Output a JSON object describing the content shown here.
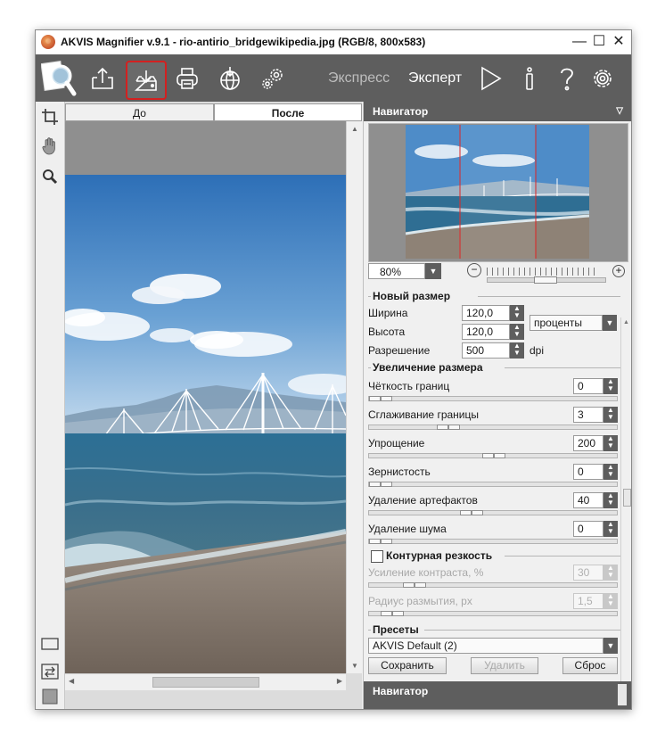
{
  "window": {
    "title": "AKVIS Magnifier v.9.1 - rio-antirio_bridgewikipedia.jpg (RGB/8, 800x583)",
    "minimize": "—",
    "maximize": "☐",
    "close": "✕"
  },
  "toolbar": {
    "icons": [
      "open-image-icon",
      "save-image-icon",
      "print-icon",
      "share-web-icon",
      "plugins-gear-icon"
    ],
    "active_icon": "save-image-icon",
    "mode_express": "Экспресс",
    "mode_expert": "Эксперт",
    "active_mode": "Эксперт",
    "right_icons": [
      "run-play-icon",
      "info-icon",
      "help-icon",
      "settings-gear-icon"
    ]
  },
  "left_tools": [
    "crop-icon",
    "hand-icon",
    "zoom-icon"
  ],
  "canvas": {
    "tab_before": "До",
    "tab_after": "После",
    "active_tab": "После"
  },
  "navigator": {
    "title": "Навигатор",
    "zoom": "80%",
    "zoom_slider_level": 0.65
  },
  "new_size": {
    "title": "Новый размер",
    "width_label": "Ширина",
    "width_value": "120,0",
    "height_label": "Высота",
    "height_value": "120,0",
    "unit": "проценты",
    "resolution_label": "Разрешение",
    "resolution_value": "500",
    "resolution_unit": "dpi"
  },
  "enlarge": {
    "title": "Увеличение размера",
    "params": [
      {
        "label": "Чёткость границ",
        "value": "0",
        "level": 0.0
      },
      {
        "label": "Сглаживание границы",
        "value": "3",
        "level": 0.3
      },
      {
        "label": "Упрощение",
        "value": "200",
        "level": 0.5
      },
      {
        "label": "Зернистость",
        "value": "0",
        "level": 0.0
      },
      {
        "label": "Удаление артефактов",
        "value": "40",
        "level": 0.4
      },
      {
        "label": "Удаление шума",
        "value": "0",
        "level": 0.0
      }
    ]
  },
  "sharpness": {
    "title": "Контурная резкость",
    "enabled": false,
    "params": [
      {
        "label": "Усиление контраста, %",
        "value": "30",
        "level": 0.15
      },
      {
        "label": "Радиус размытия, px",
        "value": "1,5",
        "level": 0.05
      }
    ]
  },
  "presets": {
    "title": "Пресеты",
    "selected": "AKVIS Default (2)",
    "save_label": "Сохранить",
    "delete_label": "Удалить",
    "reset_label": "Сброс"
  },
  "bottom_panel": {
    "title": "Навигатор"
  },
  "colors": {
    "toolbar_bg": "#5e5e5e",
    "active_border": "#d32020",
    "panel_bg": "#f0f0f0"
  }
}
